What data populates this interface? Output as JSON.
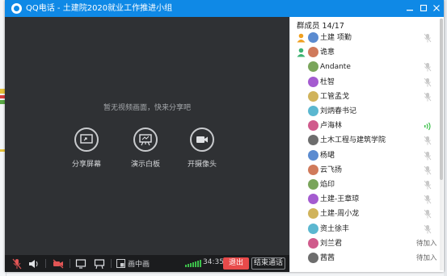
{
  "window": {
    "title": "QQ电话 - 土建院2020就业工作推进小组"
  },
  "video": {
    "empty_message": "暂无视频画面，快来分享吧",
    "actions": [
      {
        "label": "分享屏幕",
        "icon": "share-screen-icon"
      },
      {
        "label": "演示白板",
        "icon": "whiteboard-icon"
      },
      {
        "label": "开摄像头",
        "icon": "camera-icon"
      }
    ]
  },
  "toolbar": {
    "picture_in_picture_label": "画中画",
    "timer": "34:35",
    "exit_label": "退出",
    "end_call_label": "结束通话"
  },
  "panel": {
    "header": "群成员 14/17",
    "members": [
      {
        "name": "土建 项勤",
        "role": "owner",
        "mic": "muted",
        "status": ""
      },
      {
        "name": "诡意",
        "role": "admin",
        "mic": "none",
        "status": ""
      },
      {
        "name": "Andante",
        "role": "",
        "mic": "muted",
        "status": ""
      },
      {
        "name": "杜智",
        "role": "",
        "mic": "muted",
        "status": ""
      },
      {
        "name": "工管孟戈",
        "role": "",
        "mic": "muted",
        "status": ""
      },
      {
        "name": "刘炳春书记",
        "role": "",
        "mic": "none",
        "status": ""
      },
      {
        "name": "卢海林",
        "role": "",
        "mic": "speaking",
        "status": ""
      },
      {
        "name": "土木工程与建筑学院",
        "role": "",
        "mic": "muted",
        "status": ""
      },
      {
        "name": "杨珺",
        "role": "",
        "mic": "muted",
        "status": ""
      },
      {
        "name": "云飞扬",
        "role": "",
        "mic": "muted",
        "status": ""
      },
      {
        "name": "焰印",
        "role": "",
        "mic": "muted",
        "status": ""
      },
      {
        "name": "土建-王章琼",
        "role": "",
        "mic": "muted",
        "status": ""
      },
      {
        "name": "土建-周小龙",
        "role": "",
        "mic": "muted",
        "status": ""
      },
      {
        "name": "资土徐丰",
        "role": "",
        "mic": "muted",
        "status": ""
      },
      {
        "name": "刘兰君",
        "role": "",
        "mic": "none",
        "status": "待加入"
      },
      {
        "name": "茜茜",
        "role": "",
        "mic": "none",
        "status": "待加入"
      }
    ]
  },
  "colors": {
    "titlebar": "#0f89e6",
    "exit_button": "#e84a4a",
    "speaking": "#3cc04a",
    "muted": "#c8c8c8"
  }
}
